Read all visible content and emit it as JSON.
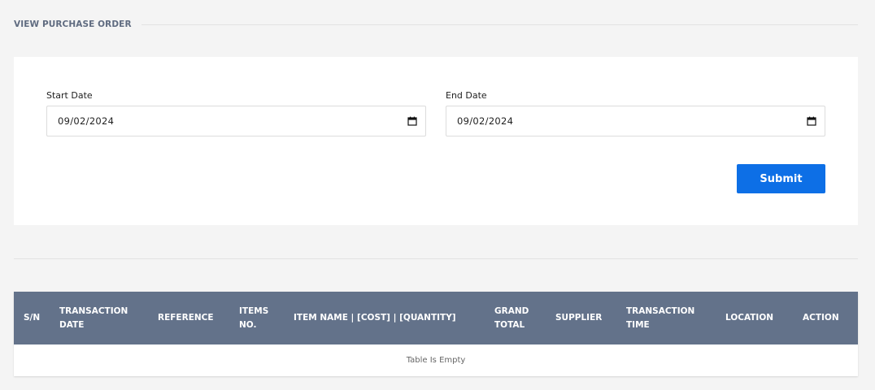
{
  "page": {
    "title": "VIEW PURCHASE ORDER"
  },
  "filters": {
    "start_date": {
      "label": "Start Date",
      "value": "09/02/2024"
    },
    "end_date": {
      "label": "End Date",
      "value": "09/02/2024"
    },
    "submit_label": "Submit"
  },
  "table": {
    "columns": [
      "S/N",
      "TRANSACTION\nDATE",
      "REFERENCE",
      "ITEMS\nNO.",
      "ITEM NAME | [COST] | [QUANTITY]",
      "GRAND\nTOTAL",
      "SUPPLIER",
      "TRANSACTION\nTIME",
      "LOCATION",
      "ACTION"
    ],
    "empty_message": "Table Is Empty"
  },
  "colors": {
    "accent": "#0d6fe6",
    "table_header": "#63728a",
    "background": "#f4f4f4"
  },
  "icons": {
    "date_picker": "calendar-icon"
  }
}
